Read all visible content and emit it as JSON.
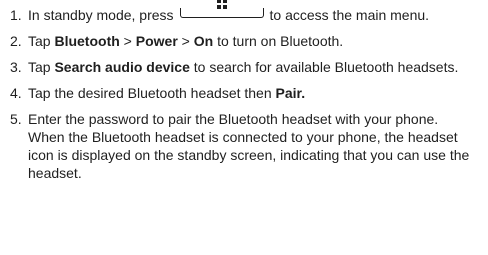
{
  "steps": [
    {
      "num": "1.",
      "before": "In standby mode, press",
      "icon": "menu-key-icon",
      "after": "to access the main menu."
    },
    {
      "num": "2.",
      "t1": "Tap ",
      "b1": "Bluetooth",
      "t2": " > ",
      "b2": "Power",
      "t3": " > ",
      "b3": "On",
      "t4": " to turn on Bluetooth."
    },
    {
      "num": "3.",
      "t1": "Tap ",
      "b1": "Search audio device",
      "t2": " to search for available Bluetooth headsets."
    },
    {
      "num": "4.",
      "t1": "Tap the desired Bluetooth headset then ",
      "b1": "Pair."
    },
    {
      "num": "5.",
      "t1": "Enter the password to pair the Bluetooth headset with your phone.",
      "t2": "When the Bluetooth headset is connected to your phone, the headset icon is displayed on the standby screen, indicating that you can use the headset."
    }
  ]
}
